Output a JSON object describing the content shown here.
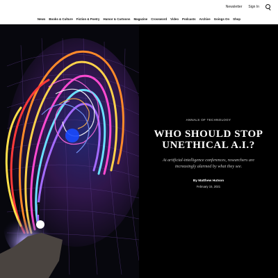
{
  "header": {
    "newsletter_label": "Newsletter",
    "signin_label": "Sign In",
    "search_icon": "search-icon"
  },
  "nav": {
    "items": [
      "News",
      "Books & Culture",
      "Fiction & Poetry",
      "Humor & Cartoons",
      "Magazine",
      "Crossword",
      "Video",
      "Podcasts",
      "Archive",
      "Goings On",
      "Shop"
    ]
  },
  "article": {
    "rubric": "ANNALS OF TECHNOLOGY",
    "headline_line1": "WHO SHOULD STOP",
    "headline_line2": "UNETHICAL A.I.?",
    "dek": "At artificial-intelligence conferences, researchers are increasingly alarmed by what they see.",
    "byline": "By Matthew Hutson",
    "date": "February 15, 2021"
  },
  "colors": {
    "panel_background": "#000000",
    "page_background": "#ffffff"
  }
}
